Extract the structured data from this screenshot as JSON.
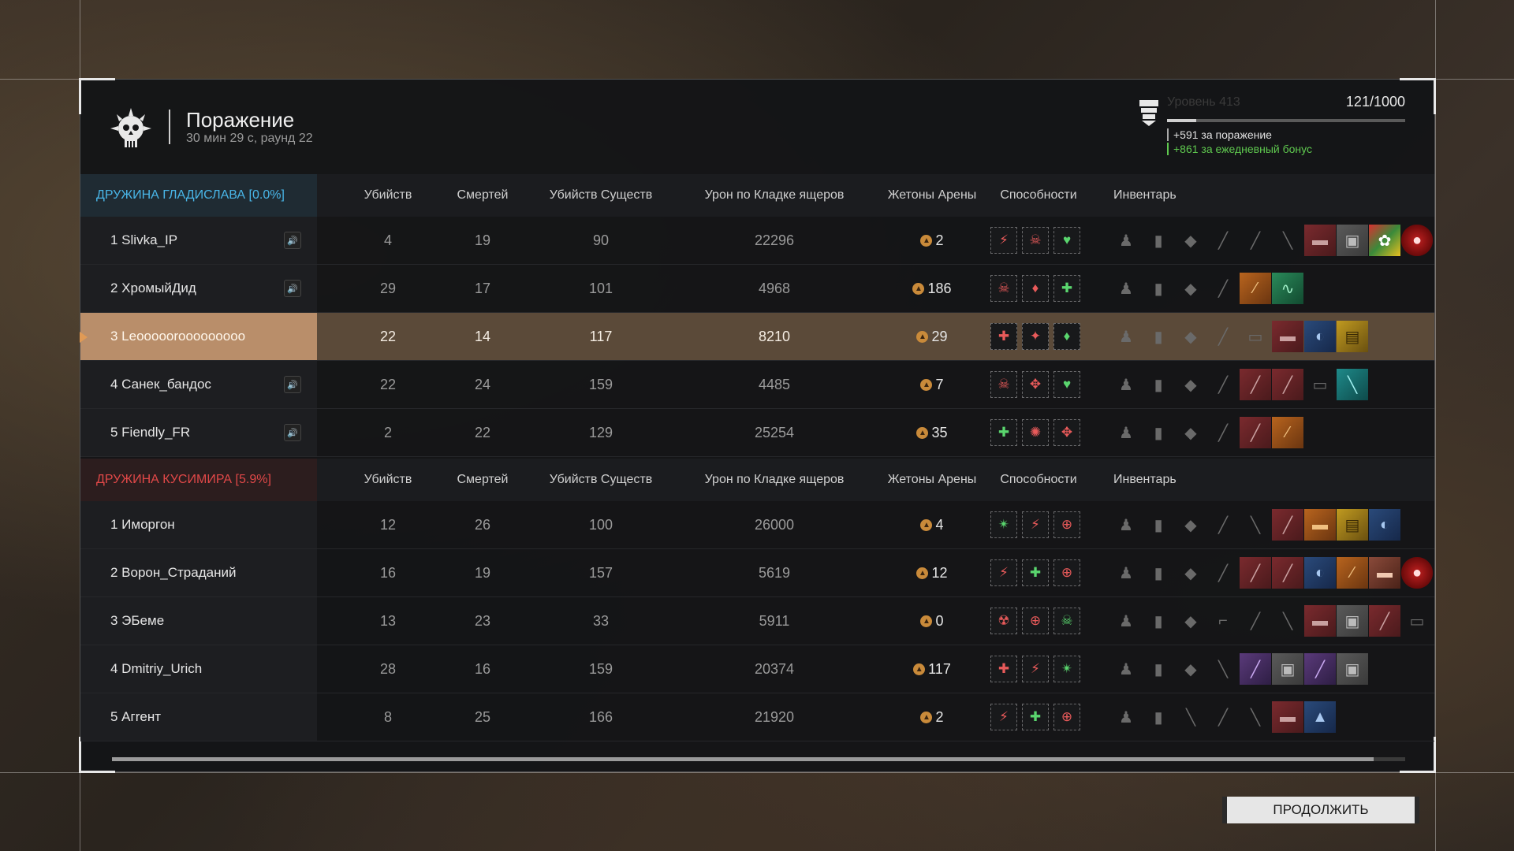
{
  "header": {
    "title": "Поражение",
    "subtitle": "30 мин 29 с, раунд 22"
  },
  "xp": {
    "level": "Уровень 413",
    "count": "121/1000",
    "progress": 0.121,
    "defeat_bonus": "+591 за поражение",
    "daily_bonus": "+861 за ежедневный бонус"
  },
  "columns": [
    "Убийств",
    "Смертей",
    "Убийств Существ",
    "Урон по Кладке ящеров",
    "Жетоны Арены",
    "Способности",
    "Инвентарь"
  ],
  "team1": {
    "name": "ДРУЖИНА ГЛАДИСЛАВА [0.0%]",
    "players": [
      {
        "name": "1 Slivka_IP",
        "kills": "4",
        "deaths": "19",
        "creature_kills": "90",
        "nest_damage": "22296",
        "tokens": "2",
        "speaker": true,
        "abilities": [
          [
            "red",
            "⚡"
          ],
          [
            "red",
            "☠"
          ],
          [
            "green",
            "♥"
          ]
        ],
        "inventory": [
          [
            "",
            "♟"
          ],
          [
            "",
            "▮"
          ],
          [
            "",
            "◆"
          ],
          [
            "",
            "╱"
          ],
          [
            "",
            "╱"
          ],
          [
            "",
            "╲"
          ],
          [
            "c-red",
            "▬"
          ],
          [
            "c-gray",
            "▣"
          ],
          [
            "c-multi",
            "✿"
          ],
          [
            "c-crimson",
            "●"
          ]
        ]
      },
      {
        "name": "2 ХромыйДид",
        "kills": "29",
        "deaths": "17",
        "creature_kills": "101",
        "nest_damage": "4968",
        "tokens": "186",
        "speaker": true,
        "abilities": [
          [
            "red",
            "☠"
          ],
          [
            "red",
            "♦"
          ],
          [
            "green",
            "✚"
          ]
        ],
        "inventory": [
          [
            "",
            "♟"
          ],
          [
            "",
            "▮"
          ],
          [
            "",
            "◆"
          ],
          [
            "",
            "╱"
          ],
          [
            "c-orange",
            "⁄"
          ],
          [
            "c-green",
            "∿"
          ]
        ]
      },
      {
        "name": "3 Leooooorooooooooo",
        "kills": "22",
        "deaths": "14",
        "creature_kills": "117",
        "nest_damage": "8210",
        "tokens": "29",
        "speaker": false,
        "highlight": true,
        "abilities": [
          [
            "red",
            "✚"
          ],
          [
            "red",
            "✦"
          ],
          [
            "green",
            "♦"
          ]
        ],
        "inventory": [
          [
            "",
            "♟"
          ],
          [
            "",
            "▮"
          ],
          [
            "",
            "◆"
          ],
          [
            "",
            "╱"
          ],
          [
            "",
            "▭"
          ],
          [
            "c-red",
            "▬"
          ],
          [
            "c-blue",
            "◐"
          ],
          [
            "c-yellow",
            "▤"
          ]
        ]
      },
      {
        "name": "4 Санек_бандос",
        "kills": "22",
        "deaths": "24",
        "creature_kills": "159",
        "nest_damage": "4485",
        "tokens": "7",
        "speaker": true,
        "abilities": [
          [
            "red",
            "☠"
          ],
          [
            "red",
            "✥"
          ],
          [
            "green",
            "♥"
          ]
        ],
        "inventory": [
          [
            "",
            "♟"
          ],
          [
            "",
            "▮"
          ],
          [
            "",
            "◆"
          ],
          [
            "",
            "╱"
          ],
          [
            "c-red",
            "╱"
          ],
          [
            "c-red",
            "╱"
          ],
          [
            "",
            "▭"
          ],
          [
            "c-teal",
            "╲"
          ]
        ]
      },
      {
        "name": "5 Fiendly_FR",
        "kills": "2",
        "deaths": "22",
        "creature_kills": "129",
        "nest_damage": "25254",
        "tokens": "35",
        "speaker": true,
        "abilities": [
          [
            "green",
            "✚"
          ],
          [
            "red",
            "✺"
          ],
          [
            "red",
            "✥"
          ]
        ],
        "inventory": [
          [
            "",
            "♟"
          ],
          [
            "",
            "▮"
          ],
          [
            "",
            "◆"
          ],
          [
            "",
            "╱"
          ],
          [
            "c-red",
            "╱"
          ],
          [
            "c-orange",
            "⁄"
          ]
        ]
      }
    ]
  },
  "team2": {
    "name": "ДРУЖИНА КУСИМИРА [5.9%]",
    "players": [
      {
        "name": "1 Иморгон",
        "kills": "12",
        "deaths": "26",
        "creature_kills": "100",
        "nest_damage": "26000",
        "tokens": "4",
        "abilities": [
          [
            "green",
            "✴"
          ],
          [
            "red",
            "⚡"
          ],
          [
            "red",
            "⊕"
          ]
        ],
        "inventory": [
          [
            "",
            "♟"
          ],
          [
            "",
            "▮"
          ],
          [
            "",
            "◆"
          ],
          [
            "",
            "╱"
          ],
          [
            "",
            "╲"
          ],
          [
            "c-red",
            "╱"
          ],
          [
            "c-orange",
            "▬"
          ],
          [
            "c-yellow",
            "▤"
          ],
          [
            "c-blue",
            "◐"
          ]
        ]
      },
      {
        "name": "2 Ворон_Страданий",
        "kills": "16",
        "deaths": "19",
        "creature_kills": "157",
        "nest_damage": "5619",
        "tokens": "12",
        "abilities": [
          [
            "red",
            "⚡"
          ],
          [
            "green",
            "✚"
          ],
          [
            "red",
            "⊕"
          ]
        ],
        "inventory": [
          [
            "",
            "♟"
          ],
          [
            "",
            "▮"
          ],
          [
            "",
            "◆"
          ],
          [
            "",
            "╱"
          ],
          [
            "c-red",
            "╱"
          ],
          [
            "c-red",
            "╱"
          ],
          [
            "c-blue",
            "◐"
          ],
          [
            "c-orange",
            "⁄"
          ],
          [
            "c-brown",
            "▬"
          ],
          [
            "c-crimson",
            "●"
          ]
        ]
      },
      {
        "name": "3 ЭБеме",
        "kills": "13",
        "deaths": "23",
        "creature_kills": "33",
        "nest_damage": "5911",
        "tokens": "0",
        "abilities": [
          [
            "red",
            "☢"
          ],
          [
            "red",
            "⊕"
          ],
          [
            "green",
            "☠"
          ]
        ],
        "inventory": [
          [
            "",
            "♟"
          ],
          [
            "",
            "▮"
          ],
          [
            "",
            "◆"
          ],
          [
            "",
            "⌐"
          ],
          [
            "",
            "╱"
          ],
          [
            "",
            "╲"
          ],
          [
            "c-red",
            "▬"
          ],
          [
            "c-gray",
            "▣"
          ],
          [
            "c-red",
            "╱"
          ],
          [
            "",
            "▭"
          ]
        ]
      },
      {
        "name": "4 Dmitriy_Urich",
        "kills": "28",
        "deaths": "16",
        "creature_kills": "159",
        "nest_damage": "20374",
        "tokens": "117",
        "abilities": [
          [
            "red",
            "✚"
          ],
          [
            "red",
            "⚡"
          ],
          [
            "green",
            "✴"
          ]
        ],
        "inventory": [
          [
            "",
            "♟"
          ],
          [
            "",
            "▮"
          ],
          [
            "",
            "◆"
          ],
          [
            "",
            "╲"
          ],
          [
            "c-purple",
            "╱"
          ],
          [
            "c-gray",
            "▣"
          ],
          [
            "c-purple",
            "╱"
          ],
          [
            "c-gray",
            "▣"
          ]
        ]
      },
      {
        "name": "5 Агrент",
        "kills": "8",
        "deaths": "25",
        "creature_kills": "166",
        "nest_damage": "21920",
        "tokens": "2",
        "abilities": [
          [
            "red",
            "⚡"
          ],
          [
            "green",
            "✚"
          ],
          [
            "red",
            "⊕"
          ]
        ],
        "inventory": [
          [
            "",
            "♟"
          ],
          [
            "",
            "▮"
          ],
          [
            "",
            "╲"
          ],
          [
            "",
            "╱"
          ],
          [
            "",
            "╲"
          ],
          [
            "c-red",
            "▬"
          ],
          [
            "c-blue",
            "▲"
          ]
        ]
      }
    ]
  },
  "continue_label": "ПРОДОЛЖИТЬ",
  "colors": {
    "team1": "#49b6e8",
    "team2": "#e04848",
    "highlight_row": "#b98e6a",
    "ability_red": "#e85a5a",
    "ability_green": "#5ad66e",
    "token": "#c98a3a"
  }
}
